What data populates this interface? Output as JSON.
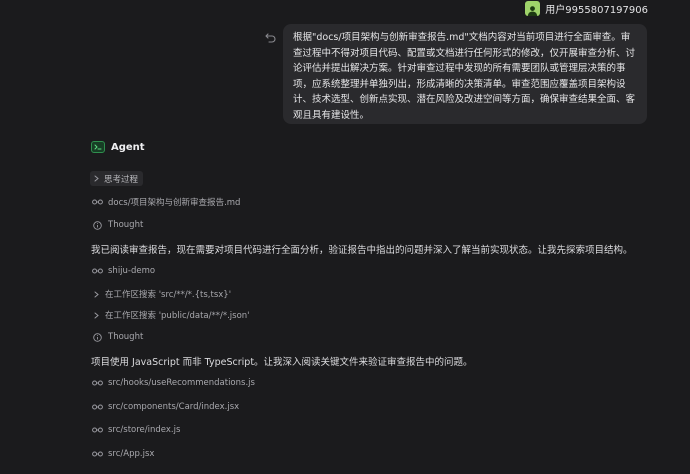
{
  "user": {
    "name": "用户9955807197906"
  },
  "user_message": "根据\"docs/项目架构与创新审查报告.md\"文档内容对当前项目进行全面审查。审查过程中不得对项目代码、配置或文档进行任何形式的修改，仅开展审查分析、讨论评估并提出解决方案。针对审查过程中发现的所有需要团队或管理层决策的事项，应系统整理并单独列出，形成清晰的决策清单。审查范围应覆盖项目架构设计、技术选型、创新点实现、潜在风险及改进空间等方面，确保审查结果全面、客观且具有建设性。",
  "agent": {
    "name": "Agent",
    "thinking_label": "思考过程",
    "steps": {
      "read_report": "docs/项目架构与创新审查报告.md",
      "thought_1": "Thought",
      "para_1": "我已阅读审查报告，现在需要对项目代码进行全面分析，验证报告中指出的问题并深入了解当前实现状态。让我先探索项目结构。",
      "read_demo": "shiju-demo",
      "search_1": "在工作区搜索 'src/**/*.{ts,tsx}'",
      "search_2": "在工作区搜索 'public/data/**/*.json'",
      "thought_2": "Thought",
      "para_2": "项目使用 JavaScript 而非 TypeScript。让我深入阅读关键文件来验证审查报告中的问题。",
      "file_1": "src/hooks/useRecommendations.js",
      "file_2": "src/components/Card/index.jsx",
      "file_3": "src/store/index.js",
      "file_4": "src/App.jsx"
    }
  },
  "colors": {
    "background": "#1b1b1d",
    "bubble": "#2a2a2d",
    "avatar": "#9fd36a",
    "agent_accent": "#2f8f4e"
  },
  "icons": {
    "read": "glasses-icon",
    "thought": "info-circle-icon",
    "expand": "chevron-right-icon",
    "undo": "undo-icon"
  }
}
